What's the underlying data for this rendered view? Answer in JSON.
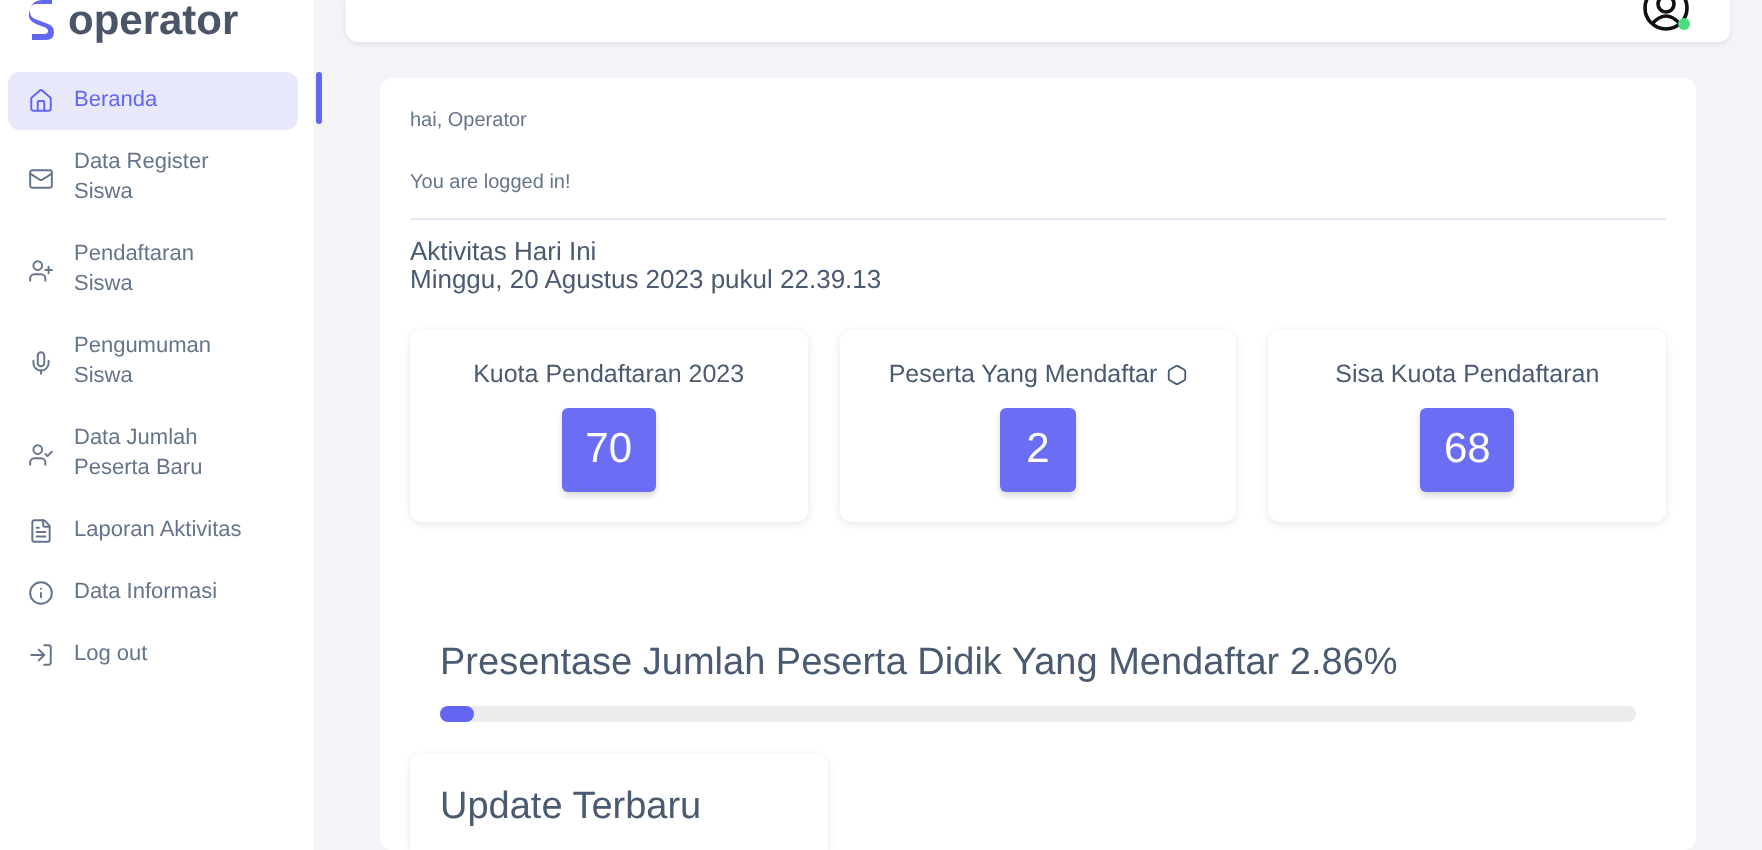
{
  "sidebar": {
    "brand": "operator",
    "items": [
      {
        "label": "Beranda",
        "selected": true
      },
      {
        "label": "Data Register Siswa",
        "selected": false
      },
      {
        "label": "Pendaftaran Siswa",
        "selected": false
      },
      {
        "label": "Pengumuman Siswa",
        "selected": false
      },
      {
        "label": "Data Jumlah Peserta Baru",
        "selected": false
      },
      {
        "label": "Laporan Aktivitas",
        "selected": false
      },
      {
        "label": "Data Informasi",
        "selected": false
      },
      {
        "label": "Log out",
        "selected": false
      }
    ]
  },
  "header": {
    "user_online": true
  },
  "main": {
    "greeting": "hai, Operator",
    "status": "You are logged in!",
    "activity_title": "Aktivitas Hari Ini",
    "datetime": "Minggu, 20 Agustus 2023 pukul 22.39.13",
    "stats": [
      {
        "label": "Kuota Pendaftaran 2023",
        "value": "70",
        "has_icon": false
      },
      {
        "label": "Peserta Yang Mendaftar",
        "value": "2",
        "has_icon": true
      },
      {
        "label": "Sisa Kuota Pendaftaran",
        "value": "68",
        "has_icon": false
      }
    ],
    "progress": {
      "title": "Presentase Jumlah Peserta Didik Yang Mendaftar 2.86%",
      "level": 0.0286
    },
    "updates_title": "Update Terbaru"
  }
}
